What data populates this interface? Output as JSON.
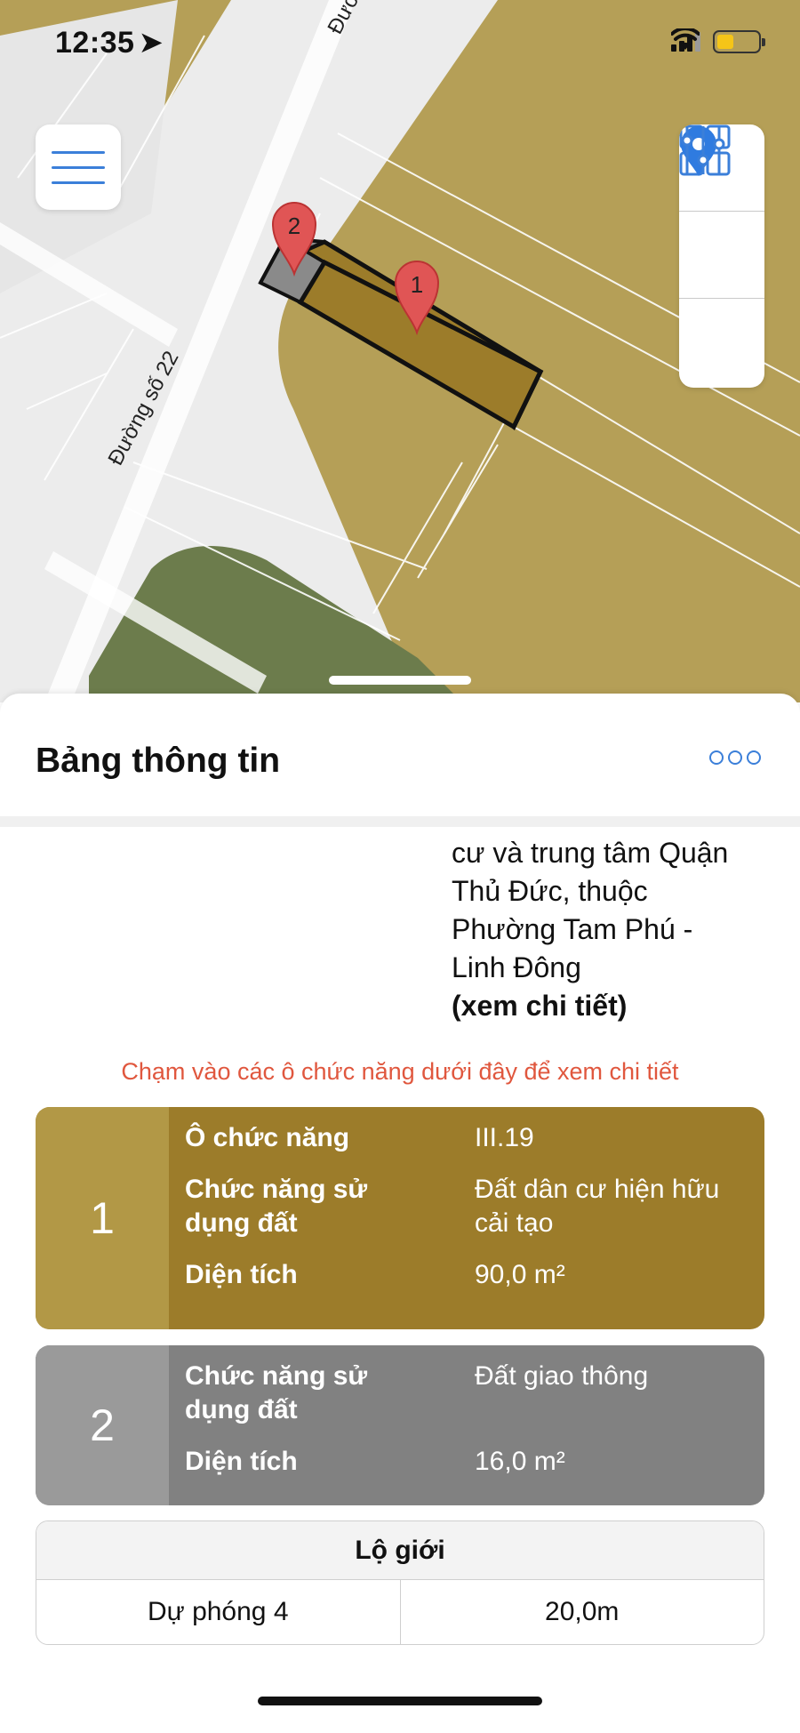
{
  "status_bar": {
    "time": "12:35",
    "location_icon": "location-arrow-icon",
    "signal_icon": "cellular-signal-icon",
    "wifi_icon": "wifi-icon",
    "battery_icon": "battery-icon",
    "battery_color": "#f5c518"
  },
  "map": {
    "street_labels": [
      "Đường số 22",
      "Đườ"
    ],
    "markers": [
      "1",
      "2"
    ],
    "colors": {
      "residential": "#b59f57",
      "selected_parcel": "#9c7c2a",
      "traffic_parcel": "#8a8a8a",
      "green_area": "#6c7c4c",
      "road": "#ececec",
      "marker": "#e05555"
    },
    "buttons": {
      "menu_icon": "hamburger-menu-icon",
      "layers_icon": "grid-layers-icon",
      "location_icon": "map-pin-icon",
      "filters_icon": "sliders-icon"
    }
  },
  "sheet": {
    "title": "Bảng thông tin",
    "more_icon": "more-dots-icon",
    "description_lines": [
      "cư và trung tâm Quận",
      "Thủ Đức, thuộc",
      "Phường Tam Phú -",
      "Linh Đông"
    ],
    "detail_link": "(xem chi tiết)",
    "hint": "Chạm vào các ô chức năng dưới đây để xem chi tiết",
    "cards": [
      {
        "number": "1",
        "rows": [
          {
            "label": "Ô chức năng",
            "value": "III.19"
          },
          {
            "label": "Chức năng sử dụng đất",
            "value": "Đất dân cư hiện hữu cải tạo"
          },
          {
            "label": "Diện tích",
            "value": "90,0 m²"
          }
        ]
      },
      {
        "number": "2",
        "rows": [
          {
            "label": "Chức năng sử dụng đất",
            "value": "Đất giao thông"
          },
          {
            "label": "Diện tích",
            "value": "16,0 m²"
          }
        ]
      }
    ],
    "road_table": {
      "header": "Lộ giới",
      "name": "Dự phóng 4",
      "width": "20,0m"
    }
  }
}
